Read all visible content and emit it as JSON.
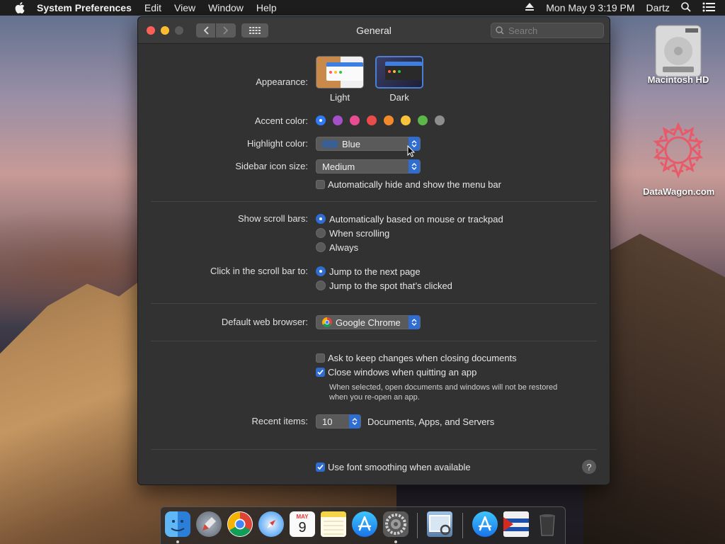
{
  "menubar": {
    "app_name": "System Preferences",
    "items": [
      "Edit",
      "View",
      "Window",
      "Help"
    ],
    "datetime": "Mon May 9  3:19 PM",
    "user": "Dartz"
  },
  "window": {
    "title": "General",
    "search_placeholder": "Search"
  },
  "appearance": {
    "label": "Appearance:",
    "options": [
      {
        "label": "Light",
        "selected": false
      },
      {
        "label": "Dark",
        "selected": true
      }
    ]
  },
  "accent": {
    "label": "Accent color:",
    "colors": [
      "#2f7bf5",
      "#a550c8",
      "#e94c93",
      "#ea4c4c",
      "#f28a2b",
      "#f8c23a",
      "#5bb74a",
      "#8e8e8e"
    ]
  },
  "highlight": {
    "label": "Highlight color:",
    "value": "Blue",
    "swatch": "#3a5f94"
  },
  "sidebar_icon": {
    "label": "Sidebar icon size:",
    "value": "Medium"
  },
  "auto_hide_menu": {
    "label": "Automatically hide and show the menu bar",
    "checked": false
  },
  "scroll_bars": {
    "label": "Show scroll bars:",
    "options": [
      {
        "label": "Automatically based on mouse or trackpad",
        "selected": true
      },
      {
        "label": "When scrolling",
        "selected": false
      },
      {
        "label": "Always",
        "selected": false
      }
    ]
  },
  "click_scroll": {
    "label": "Click in the scroll bar to:",
    "options": [
      {
        "label": "Jump to the next page",
        "selected": true
      },
      {
        "label": "Jump to the spot that’s clicked",
        "selected": false
      }
    ]
  },
  "browser": {
    "label": "Default web browser:",
    "value": "Google Chrome"
  },
  "ask_keep": {
    "label": "Ask to keep changes when closing documents",
    "checked": false
  },
  "close_windows": {
    "label": "Close windows when quitting an app",
    "checked": true,
    "note_line1": "When selected, open documents and windows will not be restored",
    "note_line2": "when you re-open an app."
  },
  "recent": {
    "label": "Recent items:",
    "value": "10",
    "suffix": "Documents, Apps, and Servers"
  },
  "font_smoothing": {
    "label": "Use font smoothing when available",
    "checked": true
  },
  "help": "?",
  "desktop": {
    "hd_label": "Macintosh HD",
    "site_label": "DataWagon.com"
  },
  "calendar_icon": {
    "month": "MAY",
    "day": "9"
  }
}
